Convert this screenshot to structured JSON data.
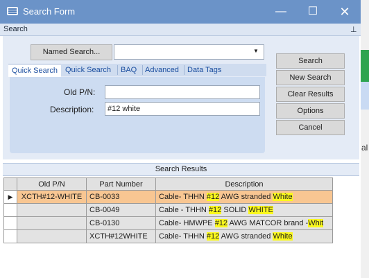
{
  "window": {
    "title": "Search Form",
    "minimize_glyph": "—",
    "maximize_glyph": "☐",
    "close_glyph": "✕"
  },
  "pane": {
    "title": "Search",
    "pin_glyph": "⊥"
  },
  "named_search": {
    "button_label": "Named Search...",
    "selected": ""
  },
  "tabs": [
    {
      "label": "Quick Search",
      "active": true
    },
    {
      "label": "Quick Search",
      "active": false
    },
    {
      "label": "BAQ",
      "active": false
    },
    {
      "label": "Advanced",
      "active": false
    },
    {
      "label": "Data Tags",
      "active": false
    }
  ],
  "fields": {
    "old_pn": {
      "label": "Old P/N:",
      "value": ""
    },
    "description": {
      "label": "Description:",
      "value": "#12 white"
    }
  },
  "actions": {
    "search": "Search",
    "new_search": "New Search",
    "clear_results": "Clear Results",
    "options": "Options",
    "cancel": "Cancel"
  },
  "results": {
    "title": "Search Results",
    "columns": [
      "Old P/N",
      "Part Number",
      "Description"
    ],
    "rows": [
      {
        "selected": true,
        "old_pn": "XCTH#12-WHITE",
        "part": "CB-0033",
        "desc": [
          [
            "Cable- THHN ",
            false
          ],
          [
            "#12",
            true
          ],
          [
            " AWG stranded ",
            false
          ],
          [
            "White",
            true
          ]
        ]
      },
      {
        "selected": false,
        "old_pn": "",
        "part": "CB-0049",
        "desc": [
          [
            "Cable - THHN ",
            false
          ],
          [
            "#12",
            true
          ],
          [
            " SOLID ",
            false
          ],
          [
            "WHITE",
            true
          ]
        ]
      },
      {
        "selected": false,
        "old_pn": "",
        "part": "CB-0130",
        "desc": [
          [
            "Cable- HMWPE ",
            false
          ],
          [
            "#12",
            true
          ],
          [
            " AWG MATCOR brand -",
            false
          ],
          [
            "Whit",
            true
          ]
        ]
      },
      {
        "selected": false,
        "old_pn": "",
        "part": "XCTH#12WHITE",
        "desc": [
          [
            "Cable- THHN ",
            false
          ],
          [
            "#12",
            true
          ],
          [
            " AWG stranded ",
            false
          ],
          [
            "White",
            true
          ]
        ]
      }
    ],
    "row_indicator": "▶"
  },
  "background_window": {
    "partial_text": "al"
  },
  "colors": {
    "titlebar": "#6b93c8",
    "selected_row": "#f8c692",
    "highlight": "#fbf91d",
    "active_tab_text": "#1c4fa0"
  }
}
